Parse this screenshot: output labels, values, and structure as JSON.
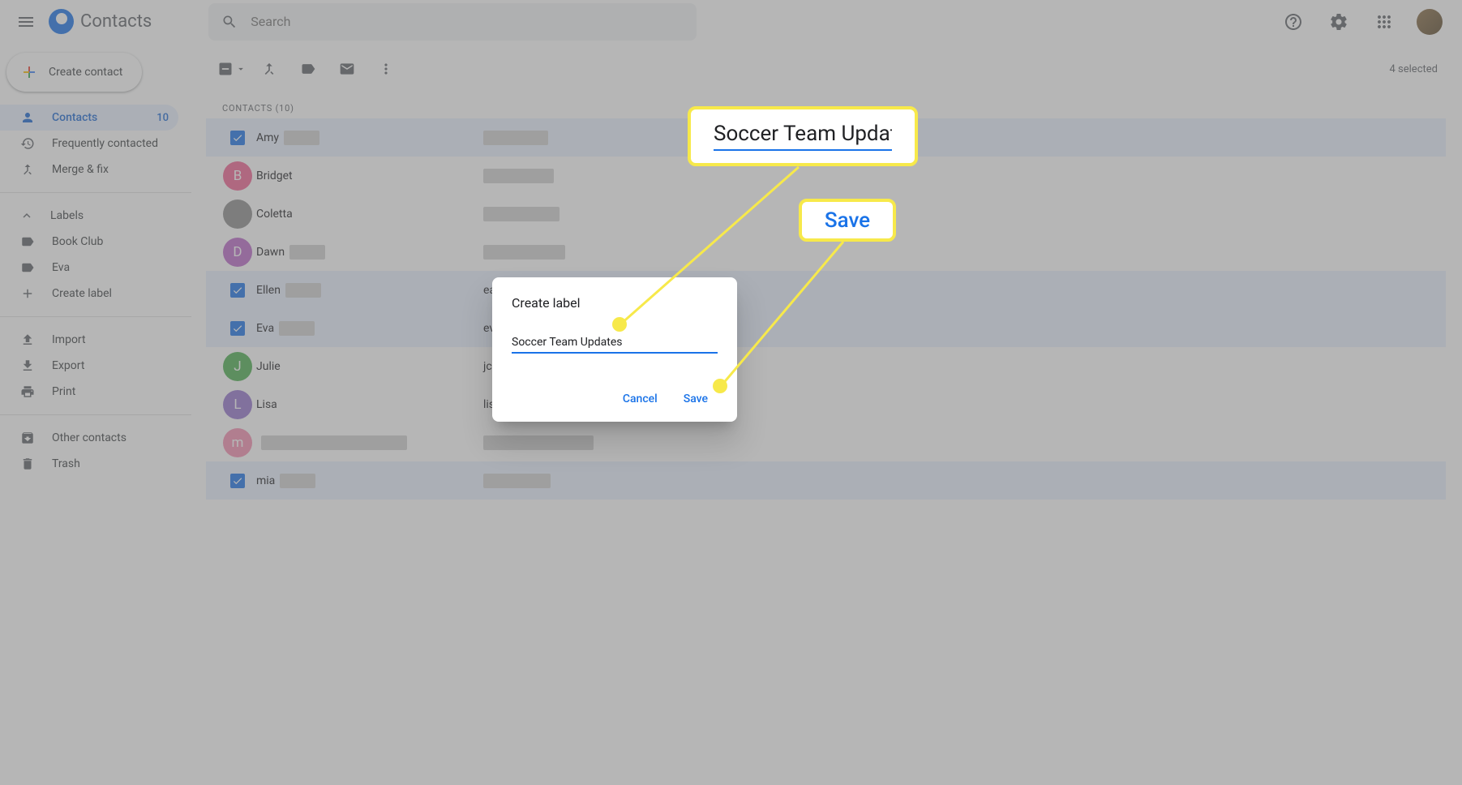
{
  "header": {
    "app_title": "Contacts",
    "search_placeholder": "Search"
  },
  "sidebar": {
    "create_contact": "Create contact",
    "nav": {
      "contacts": {
        "label": "Contacts",
        "count": "10"
      },
      "frequent": {
        "label": "Frequently contacted"
      },
      "merge": {
        "label": "Merge & fix"
      }
    },
    "labels_header": "Labels",
    "labels": [
      {
        "label": "Book Club"
      },
      {
        "label": "Eva"
      }
    ],
    "create_label": "Create label",
    "tools": {
      "import": "Import",
      "export": "Export",
      "print": "Print"
    },
    "other": "Other contacts",
    "trash": "Trash"
  },
  "toolbar": {
    "selected_text": "4 selected"
  },
  "list": {
    "header": "CONTACTS (10)",
    "rows": [
      {
        "name": "Amy",
        "selected": true,
        "avatar_color": "",
        "avatar_letter": ""
      },
      {
        "name": "Bridget",
        "selected": false,
        "avatar_color": "#f06292",
        "avatar_letter": "B"
      },
      {
        "name": "Coletta",
        "selected": false,
        "avatar_color": "#8d8d8d",
        "avatar_letter": ""
      },
      {
        "name": "Dawn",
        "selected": false,
        "avatar_color": "#ba68c8",
        "avatar_letter": "D"
      },
      {
        "name": "Ellen",
        "selected": true,
        "avatar_color": "",
        "avatar_letter": "",
        "email_prefix": "eash"
      },
      {
        "name": "Eva",
        "selected": true,
        "avatar_color": "",
        "avatar_letter": "",
        "email_prefix": "eva"
      },
      {
        "name": "Julie",
        "selected": false,
        "avatar_color": "#4caf50",
        "avatar_letter": "J",
        "email_prefix": "jcai"
      },
      {
        "name": "Lisa",
        "selected": false,
        "avatar_color": "#9575cd",
        "avatar_letter": "L",
        "email_prefix": "lisa"
      },
      {
        "name": "",
        "selected": false,
        "avatar_color": "#f48fb1",
        "avatar_letter": "m"
      },
      {
        "name": "mia",
        "selected": true,
        "avatar_color": "",
        "avatar_letter": ""
      }
    ]
  },
  "dialog": {
    "title": "Create label",
    "input_value": "Soccer Team Updates",
    "cancel": "Cancel",
    "save": "Save"
  },
  "callouts": {
    "input_value": "Soccer Team Updates",
    "save": "Save"
  }
}
